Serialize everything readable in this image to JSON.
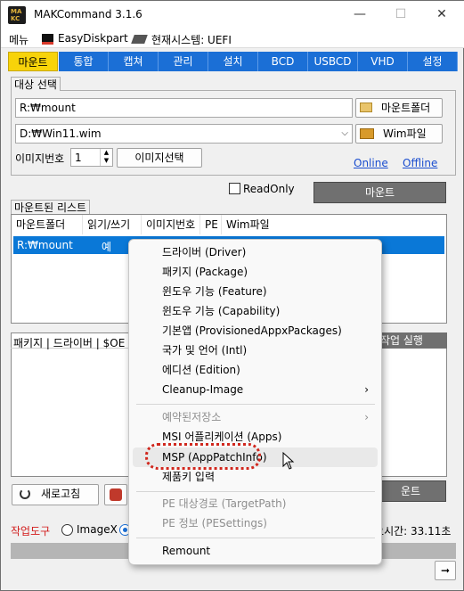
{
  "window": {
    "title": "MAKCommand 3.1.6",
    "icon_text_top": "MA",
    "icon_text_bottom": "KC",
    "minimize": "—",
    "maximize": "☐",
    "close": "✕"
  },
  "menu": {
    "items": [
      "메뉴",
      "EasyDiskpart",
      "현재시스템: UEFI"
    ]
  },
  "tabs": [
    "마운트",
    "통합",
    "캡쳐",
    "관리",
    "설치",
    "BCD",
    "USBCD",
    "VHD",
    "설정"
  ],
  "target": {
    "label": "대상 선택",
    "mount_path": "R:₩mount",
    "mount_folder_button": "마운트폴더",
    "wim_path": "D:₩Win11.wim",
    "wim_button": "Wim파일",
    "image_number_label": "이미지번호",
    "image_number": "1",
    "image_select_button": "이미지선택",
    "online_link": "Online",
    "offline_link": "Offline"
  },
  "readonly": {
    "label": "ReadOnly"
  },
  "mount_button": "마운트",
  "mounted_list": {
    "label": "마운트된 리스트",
    "columns": [
      "마운트폴더",
      "읽기/쓰기",
      "이미지번호",
      "PE",
      "Wim파일"
    ],
    "rows": [
      {
        "folder": "R:₩mount",
        "rw": "예"
      }
    ]
  },
  "package_panel": {
    "label": "패키지 | 드라이버 | $OE",
    "action_label": "작업 실행"
  },
  "refresh_button": "새로고침",
  "unmount_button": "운트",
  "tools": {
    "label": "작업도구",
    "option1": "ImageX",
    "time": "소요시간: 33.11초"
  },
  "context_menu": {
    "items": [
      "드라이버 (Driver)",
      "패키지 (Package)",
      "윈도우 기능 (Feature)",
      "윈도우 기능 (Capability)",
      "기본앱 (ProvisionedAppxPackages)",
      "국가 및 언어 (Intl)",
      "에디션 (Edition)",
      "Cleanup-Image",
      "예약된저장소",
      "MSI 어플리케이션 (Apps)",
      "MSP (AppPatchInfo)",
      "제품키 입력",
      "PE 대상경로 (TargetPath)",
      "PE 정보 (PESettings)",
      "Remount"
    ]
  },
  "colors": {
    "tab_blue": "#1b6fd6",
    "tab_active": "#f7d30a",
    "selection": "#0a78d7",
    "highlight_ring": "#d0271d"
  }
}
